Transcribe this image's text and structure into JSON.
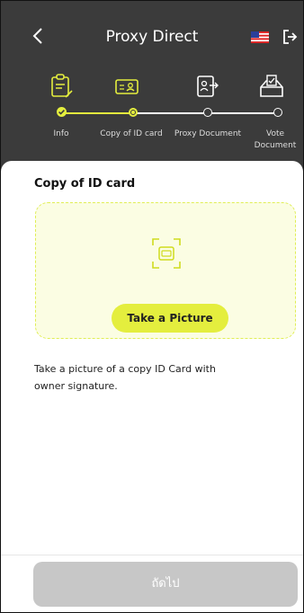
{
  "header": {
    "title": "Proxy Direct",
    "back_icon": "chevron-left-icon",
    "flag_icon": "us-flag-icon",
    "logout_icon": "logout-icon"
  },
  "stepper": {
    "steps": [
      {
        "label": "Info",
        "status": "completed",
        "icon": "clipboard-pen-icon"
      },
      {
        "label": "Copy of ID card",
        "status": "current",
        "icon": "id-card-icon"
      },
      {
        "label": "Proxy Document",
        "status": "pending",
        "icon": "proxy-document-icon"
      },
      {
        "label": "Vote Document",
        "status": "pending",
        "icon": "ballot-box-icon"
      }
    ]
  },
  "main": {
    "title": "Copy of ID card",
    "take_picture_label": "Take a Picture",
    "description": "Take a picture of a copy ID Card with owner signature.",
    "scan_icon": "scan-card-icon"
  },
  "footer": {
    "next_label": "ถัดไป"
  },
  "colors": {
    "accent": "#e4ee3e",
    "header_bg": "#3b3b3b",
    "disabled": "#c7c7c7"
  }
}
